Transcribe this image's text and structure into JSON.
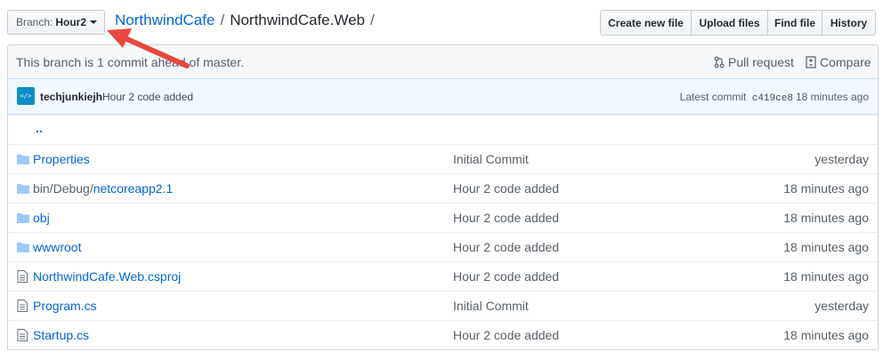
{
  "branch": {
    "prefix": "Branch:",
    "name": "Hour2"
  },
  "breadcrumb": {
    "repo": "NorthwindCafe",
    "sep1": "/",
    "folder": "NorthwindCafe.Web",
    "sep2": "/"
  },
  "file_actions": [
    "Create new file",
    "Upload files",
    "Find file",
    "History"
  ],
  "info": {
    "message": "This branch is 1 commit ahead of master.",
    "pull_request": "Pull request",
    "compare": "Compare"
  },
  "commit": {
    "avatar_text": "</>",
    "author": "techjunkiejh",
    "message": "Hour 2 code added",
    "latest_label": "Latest commit",
    "sha": "c419ce8",
    "age": "18 minutes ago"
  },
  "parent_link": "..",
  "files": [
    {
      "type": "folder",
      "prefix": "",
      "name": "Properties",
      "commit": "Initial Commit",
      "age": "yesterday"
    },
    {
      "type": "folder",
      "prefix": "bin/Debug/",
      "name": "netcoreapp2.1",
      "commit": "Hour 2 code added",
      "age": "18 minutes ago"
    },
    {
      "type": "folder",
      "prefix": "",
      "name": "obj",
      "commit": "Hour 2 code added",
      "age": "18 minutes ago"
    },
    {
      "type": "folder",
      "prefix": "",
      "name": "wwwroot",
      "commit": "Hour 2 code added",
      "age": "18 minutes ago"
    },
    {
      "type": "file",
      "prefix": "",
      "name": "NorthwindCafe.Web.csproj",
      "commit": "Hour 2 code added",
      "age": "18 minutes ago"
    },
    {
      "type": "file",
      "prefix": "",
      "name": "Program.cs",
      "commit": "Initial Commit",
      "age": "yesterday"
    },
    {
      "type": "file",
      "prefix": "",
      "name": "Startup.cs",
      "commit": "Hour 2 code added",
      "age": "18 minutes ago"
    }
  ],
  "colors": {
    "link": "#0366d6",
    "annotation_arrow": "#e8483f",
    "folder_icon": "#79b8ff"
  }
}
